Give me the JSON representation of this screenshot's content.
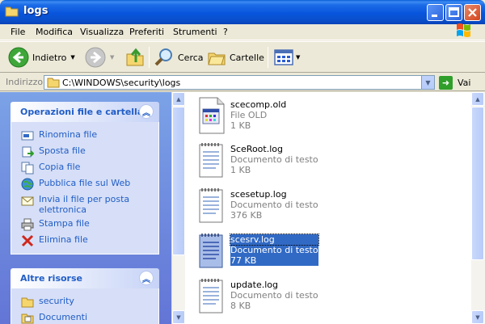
{
  "window": {
    "title": "logs"
  },
  "menu": [
    "File",
    "Modifica",
    "Visualizza",
    "Preferiti",
    "Strumenti",
    "?"
  ],
  "toolbar": {
    "back": "Indietro",
    "search": "Cerca",
    "folders": "Cartelle"
  },
  "address": {
    "label": "Indirizzo",
    "path": "C:\\WINDOWS\\security\\logs",
    "go": "Vai"
  },
  "taskpane": {
    "file_tasks": {
      "title": "Operazioni file e cartella",
      "items": [
        {
          "label": "Rinomina file",
          "icon": "rename-icon"
        },
        {
          "label": "Sposta file",
          "icon": "move-icon"
        },
        {
          "label": "Copia file",
          "icon": "copy-icon"
        },
        {
          "label": "Pubblica file sul Web",
          "icon": "web-publish-icon"
        },
        {
          "label": "Invia il file per posta elettronica",
          "icon": "email-icon"
        },
        {
          "label": "Stampa file",
          "icon": "printer-icon"
        },
        {
          "label": "Elimina file",
          "icon": "delete-icon"
        }
      ]
    },
    "other_places": {
      "title": "Altre risorse",
      "items": [
        {
          "label": "security",
          "icon": "folder-icon"
        },
        {
          "label": "Documenti",
          "icon": "documents-icon"
        }
      ]
    }
  },
  "files": [
    {
      "name": "scecomp.old",
      "type": "File OLD",
      "size": "1 KB",
      "icon": "old-file-icon",
      "selected": false
    },
    {
      "name": "SceRoot.log",
      "type": "Documento di testo",
      "size": "1 KB",
      "icon": "text-document-icon",
      "selected": false
    },
    {
      "name": "scesetup.log",
      "type": "Documento di testo",
      "size": "376 KB",
      "icon": "text-document-icon",
      "selected": false
    },
    {
      "name": "scesrv.log",
      "type": "Documento di testo",
      "size": "77 KB",
      "icon": "text-document-icon",
      "selected": true
    },
    {
      "name": "update.log",
      "type": "Documento di testo",
      "size": "8 KB",
      "icon": "text-document-icon",
      "selected": false
    }
  ],
  "colors": {
    "titlebar": "#0855dd",
    "taskpane": "#7ba2e7",
    "link": "#215dc6",
    "selection": "#316ac5"
  }
}
